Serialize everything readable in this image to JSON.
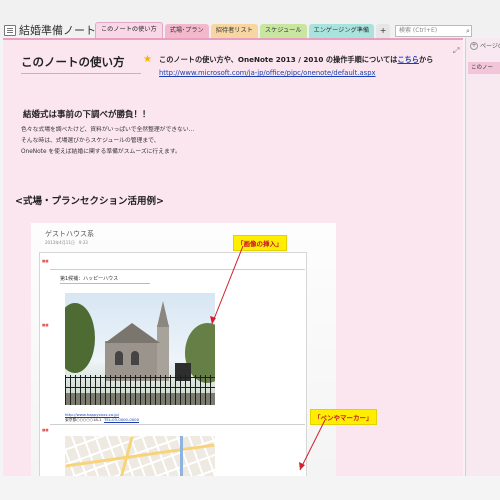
{
  "notebook": {
    "title": "結婚準備ノート"
  },
  "tabs": [
    {
      "label": "このノートの使い方"
    },
    {
      "label": "式場･プラン"
    },
    {
      "label": "招待者リスト"
    },
    {
      "label": "スケジュール"
    },
    {
      "label": "エンゲージング準備"
    },
    {
      "label": "+"
    }
  ],
  "search": {
    "placeholder": "検索 (Ctrl+E)"
  },
  "page": {
    "title": "このノートの使い方",
    "intro_prefix": "このノートの使い方や、OneNote 2013 / 2010 の操作手順については",
    "intro_link": "こちら",
    "intro_suffix": "から",
    "url": "http://www.microsoft.com/ja-jp/office/pipc/onenote/default.aspx",
    "subheading": "結婚式は事前の下調べが勝負！！",
    "paragraphs": [
      "色々な式場を調べたけど、資料がいっぱいで全然整理ができない…",
      "そんな時は、式場選びからスケジュールの管理まで、",
      "OneNote を使えば結婚に関する準備がスムーズに行えます。"
    ],
    "section_heading": "<式場・プランセクション活用例>"
  },
  "embed": {
    "title": "ゲストハウス系",
    "date": "2013年4月11日　9:33",
    "card_title": "第1候補：ハッピーハウス",
    "side_marks": [
      "■■",
      "■■",
      "■■"
    ],
    "link": "http://www.happyxxxx.co.jp/",
    "address": "東京都○○○○○18-1",
    "tel": "TEL:03-0000-0000"
  },
  "callouts": {
    "image_insert": "「画像の挿入」",
    "pen_marker": "「ペンやマーカー」"
  },
  "right_panel": {
    "add_page": "ページの",
    "page_item": "このノー"
  },
  "colors": {
    "page_bg": "#fbe6ef",
    "tab_active": "#f8d7e7",
    "link": "#1a3fb0",
    "callout_bg": "#ffee00",
    "callout_text": "#c8102e"
  }
}
